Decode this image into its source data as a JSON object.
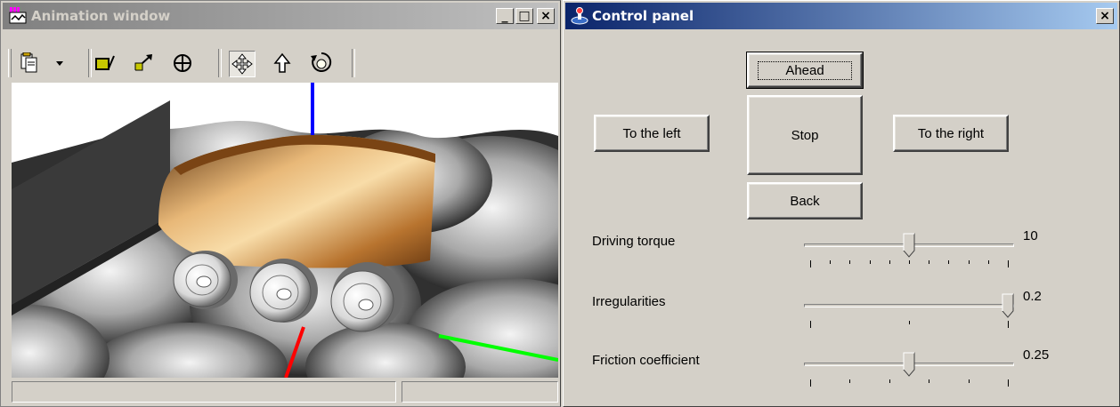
{
  "animation_window": {
    "title": "Animation window",
    "title_buttons": {
      "minimize": "_",
      "maximize": "□",
      "close": "×"
    },
    "toolbar": {
      "icons": [
        "copy-icon",
        "dropdown-arrow-icon",
        "camera-icon",
        "zoom-icon",
        "target-icon",
        "move-icon",
        "up-arrow-icon",
        "rotate-icon"
      ]
    },
    "status": {
      "left": "",
      "right": ""
    }
  },
  "control_panel": {
    "title": "Control panel",
    "close": "×",
    "buttons": {
      "ahead": "Ahead",
      "left": "To the left",
      "stop": "Stop",
      "right": "To the right",
      "back": "Back"
    },
    "sliders": [
      {
        "label": "Driving torque",
        "value": "10",
        "level": 0.5,
        "ticks": 11
      },
      {
        "label": "Irregularities",
        "value": "0.2",
        "level": 1.0,
        "ticks": 3
      },
      {
        "label": "Friction coefficient",
        "value": "0.25",
        "level": 0.5,
        "ticks": 6
      }
    ]
  },
  "colors": {
    "active_title_start": "#0a246a",
    "active_title_end": "#a6caf0",
    "inactive_title_start": "#808080",
    "inactive_title_end": "#c0c0c0",
    "face": "#d4d0c8",
    "axis_z": "#0000ff",
    "axis_x": "#ff0000",
    "axis_y": "#00ff00",
    "vehicle_body": "#b8742f"
  }
}
